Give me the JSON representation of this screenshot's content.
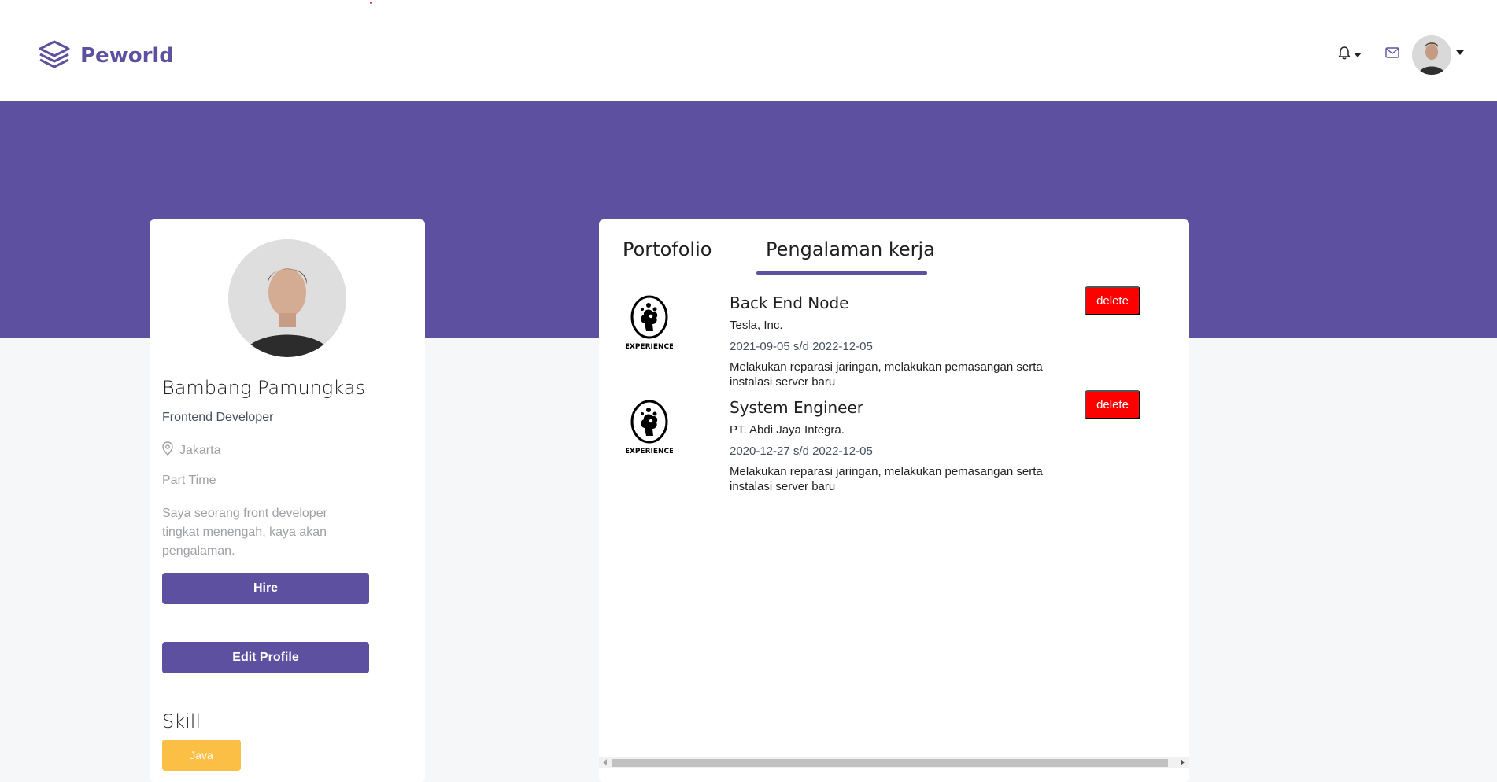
{
  "brand": {
    "name": "Peworld"
  },
  "profile": {
    "name": "Bambang Pamungkas",
    "role": "Frontend Developer",
    "location": "Jakarta",
    "job_type": "Part Time",
    "description": "Saya seorang front developer tingkat menengah, kaya akan pengalaman.",
    "hire_label": "Hire",
    "edit_label": "Edit Profile",
    "skill_title": "Skill",
    "skills": [
      "Java"
    ]
  },
  "tabs": [
    {
      "label": "Portofolio",
      "active": false
    },
    {
      "label": "Pengalaman kerja",
      "active": true
    }
  ],
  "experiences": [
    {
      "logo_text": "EXPERIENCE",
      "position": "Back End Node",
      "company": "Tesla, Inc.",
      "date": "2021-09-05 s/d 2022-12-05",
      "description": "Melakukan reparasi jaringan, melakukan pemasangan serta instalasi server baru",
      "delete_label": "delete"
    },
    {
      "logo_text": "EXPERIENCE",
      "position": "System Engineer",
      "company": "PT. Abdi Jaya Integra.",
      "date": "2020-12-27 s/d 2022-12-05",
      "description": "Melakukan reparasi jaringan, melakukan pemasangan serta instalasi server baru",
      "delete_label": "delete"
    }
  ],
  "colors": {
    "primary": "#5e50a1",
    "delete": "#ff0000",
    "skill": "#fbb017",
    "page_bg": "#f6f7f8"
  },
  "icons": [
    "layers-logo-icon",
    "bell-icon",
    "mail-icon",
    "location-pin-icon"
  ]
}
